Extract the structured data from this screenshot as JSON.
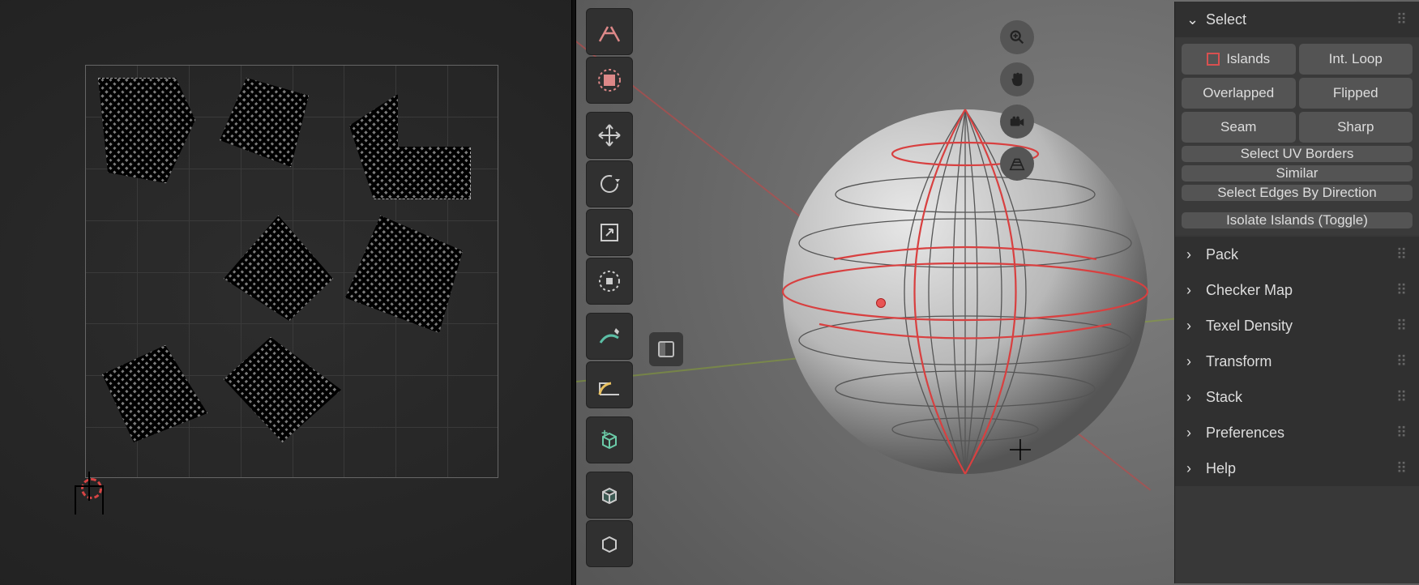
{
  "select_panel": {
    "title": "Select",
    "buttons": {
      "islands": "Islands",
      "int_loop": "Int. Loop",
      "overlapped": "Overlapped",
      "flipped": "Flipped",
      "seam": "Seam",
      "sharp": "Sharp",
      "uv_borders": "Select UV Borders",
      "similar": "Similar",
      "edges_by_dir": "Select Edges By Direction",
      "isolate": "Isolate Islands (Toggle)"
    }
  },
  "closed_panels": [
    "Pack",
    "Checker Map",
    "Texel Density",
    "Transform",
    "Stack",
    "Preferences",
    "Help"
  ],
  "tool_icons": [
    "tweak",
    "select-box",
    "move",
    "rotate",
    "scale",
    "transform",
    "annotate",
    "measure",
    "add-cube",
    "extrude",
    "bevel"
  ],
  "gizmo_icons": [
    "zoom",
    "pan",
    "camera",
    "grid"
  ]
}
